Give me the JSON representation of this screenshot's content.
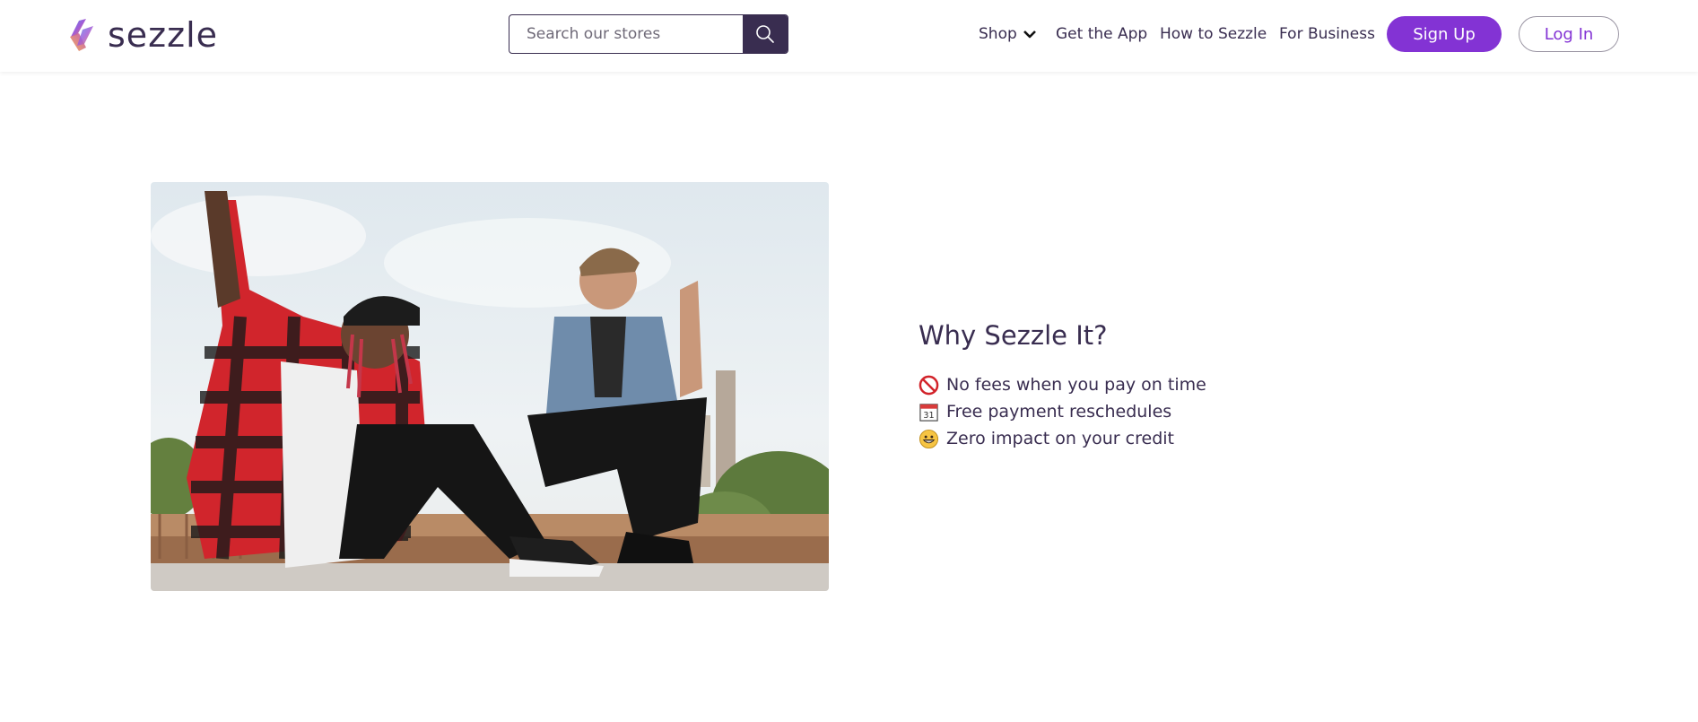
{
  "header": {
    "logo_text": "sezzle",
    "search": {
      "placeholder": "Search our stores",
      "value": ""
    },
    "nav": {
      "shop": "Shop",
      "get_app": "Get the App",
      "how_to": "How to Sezzle",
      "business": "For Business"
    },
    "sign_up": "Sign Up",
    "log_in": "Log In"
  },
  "main": {
    "heading": "Why Sezzle It?",
    "features": [
      {
        "icon": "no-entry-icon",
        "text": "No fees when you pay on time"
      },
      {
        "icon": "calendar-icon",
        "text": "Free payment reschedules"
      },
      {
        "icon": "grinning-face-icon",
        "text": "Zero impact on your credit"
      }
    ]
  },
  "colors": {
    "brand_purple": "#8333d4",
    "dark_navy": "#392d50",
    "text": "#392d50"
  }
}
